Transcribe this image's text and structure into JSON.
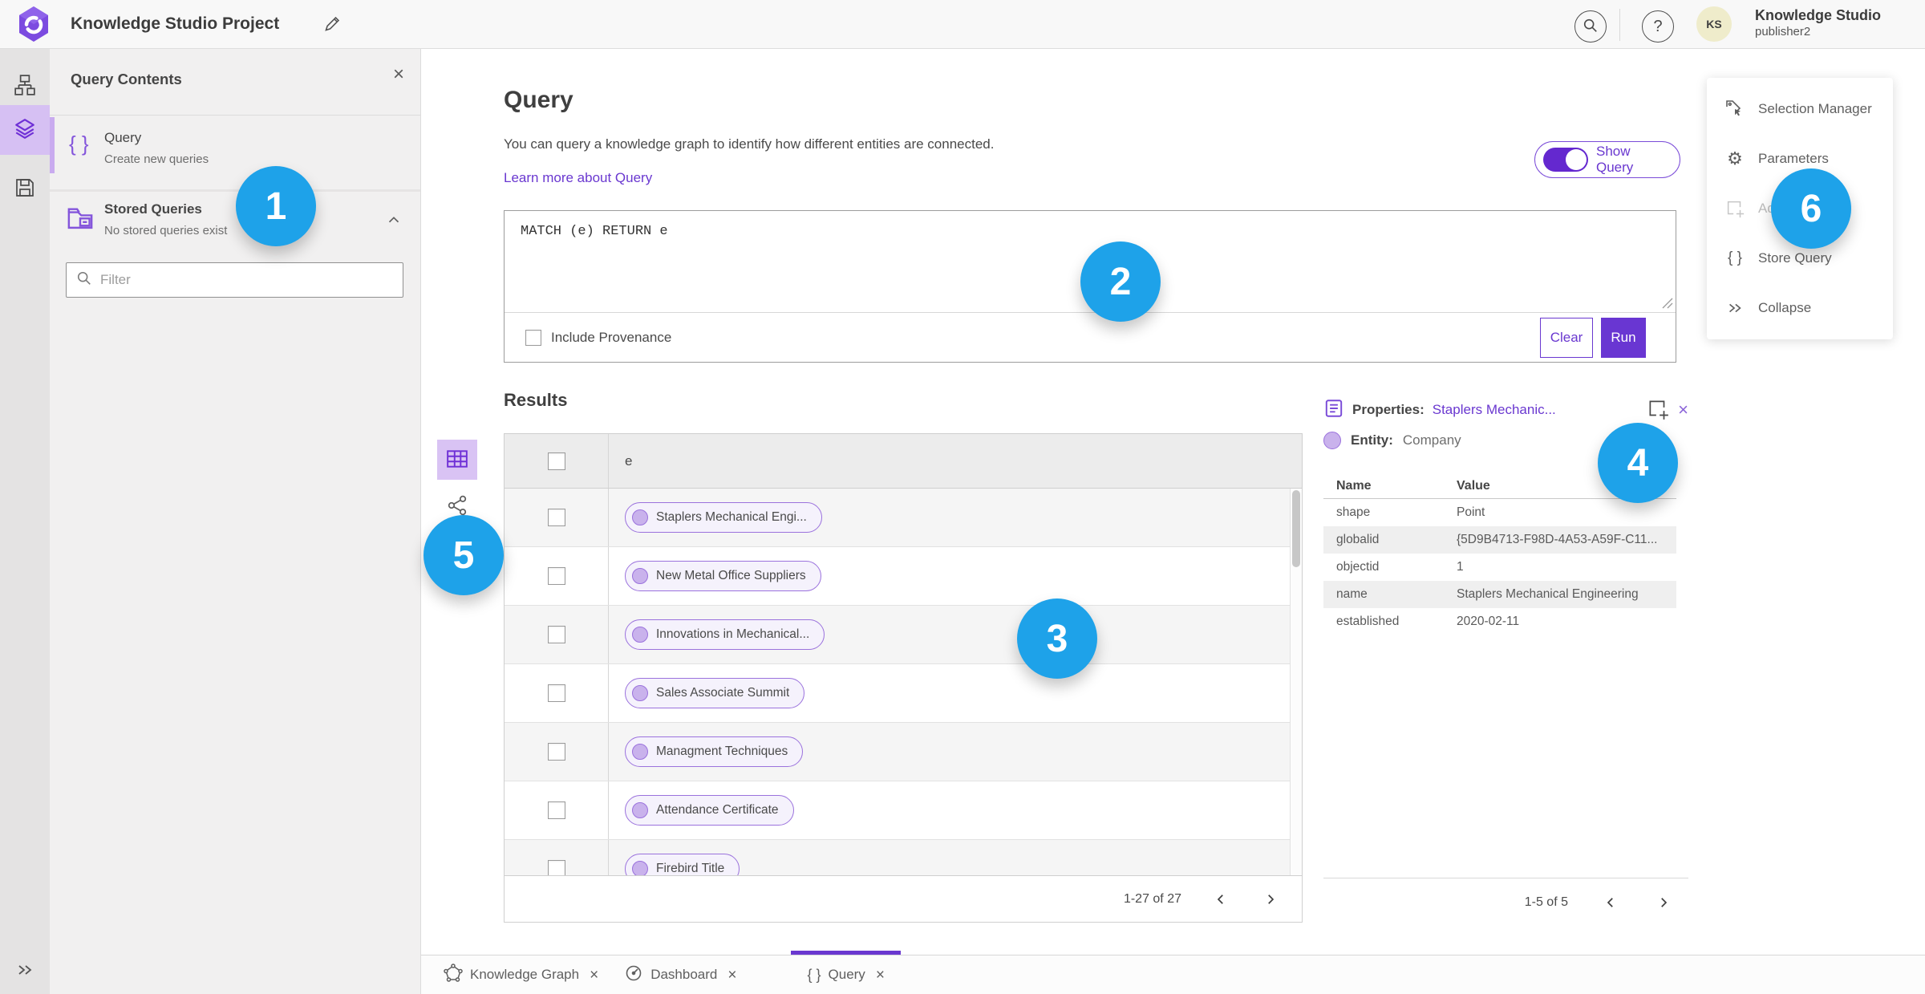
{
  "colors": {
    "accent_purple": "#6a38d0",
    "badge_blue": "#1ea2e9",
    "chip_border": "#9b72dd",
    "chip_bg": "#f5f2fc",
    "rail_active_bg": "#d6c0f3"
  },
  "glyphs": {
    "close": "×",
    "question": "?",
    "braces": "{ }",
    "gear": "⚙",
    "collapse": "»"
  },
  "topbar": {
    "title": "Knowledge Studio Project",
    "user": {
      "initials": "KS",
      "name": "Knowledge Studio",
      "role": "publisher2"
    }
  },
  "query_contents": {
    "title": "Query Contents",
    "query_item": {
      "label": "Query",
      "description": "Create new queries"
    },
    "stored_queries": {
      "label": "Stored Queries",
      "empty_text": "No stored queries exist"
    },
    "filter_placeholder": "Filter"
  },
  "query_panel": {
    "heading": "Query",
    "description": "You can query a knowledge graph to identify how different entities are connected.",
    "learn_more_link": "Learn more about Query",
    "show_query_label": "Show Query",
    "query_text": "MATCH (e) RETURN e",
    "include_provenance_label": "Include Provenance",
    "clear_button": "Clear",
    "run_button": "Run"
  },
  "results": {
    "heading": "Results",
    "column_header": "e",
    "rows": [
      "Staplers Mechanical Engi...",
      "New Metal Office Suppliers",
      "Innovations in Mechanical...",
      "Sales Associate Summit",
      "Managment Techniques",
      "Attendance Certificate",
      "Firebird Title"
    ],
    "pagination": "1-27 of 27"
  },
  "properties_panel": {
    "title_label": "Properties:",
    "title_link": "Staplers Mechanic...",
    "entity_label": "Entity:",
    "entity_value": "Company",
    "columns": [
      "Name",
      "Value"
    ],
    "rows": [
      [
        "shape",
        "Point"
      ],
      [
        "globalid",
        "{5D9B4713-F98D-4A53-A59F-C11..."
      ],
      [
        "objectid",
        "1"
      ],
      [
        "name",
        "Staplers Mechanical Engineering"
      ],
      [
        "established",
        "2020-02-11"
      ]
    ],
    "pagination": "1-5 of 5"
  },
  "side_menu": {
    "items": [
      {
        "label": "Selection Manager"
      },
      {
        "label": "Parameters"
      },
      {
        "label": "Ad"
      },
      {
        "label": "Store Query"
      },
      {
        "label": "Collapse"
      }
    ]
  },
  "tabs": [
    {
      "label": "Knowledge Graph"
    },
    {
      "label": "Dashboard"
    },
    {
      "label": "Query"
    }
  ],
  "badges": [
    "1",
    "2",
    "3",
    "4",
    "5",
    "6"
  ]
}
